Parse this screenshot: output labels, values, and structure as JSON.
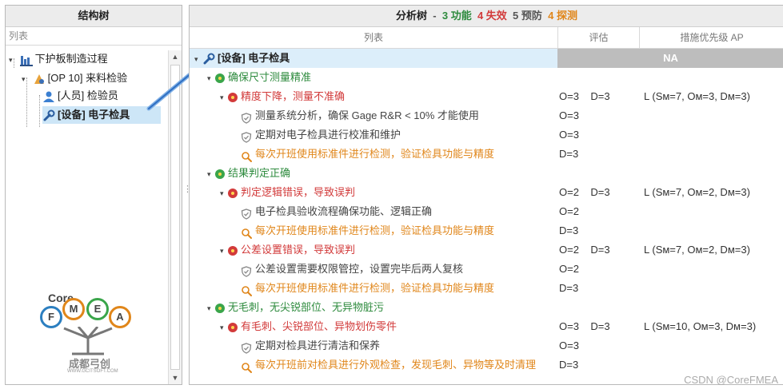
{
  "left": {
    "title": "结构树",
    "column": "列表",
    "nodes": [
      {
        "label": "下护板制造过程"
      },
      {
        "label": "[OP 10] 来料检验"
      },
      {
        "label": "[人员] 检验员"
      },
      {
        "label": "[设备] 电子检具"
      }
    ]
  },
  "right": {
    "title": "分析树",
    "title_sep": "-",
    "counts": {
      "functions": "3 功能",
      "failures": "4 失效",
      "preventions": "5 预防",
      "detections": "4 探测"
    },
    "columns": {
      "list": "列表",
      "eval": "评估",
      "ap": "措施优先级 AP"
    },
    "rows": [
      {
        "kind": "eqp",
        "text": "[设备] 电子检具",
        "ap": "NA"
      },
      {
        "kind": "fn",
        "text": "确保尺寸测量精准"
      },
      {
        "kind": "fm",
        "text": "精度下降，测量不准确",
        "eval": "O=3    D=3",
        "ap": "L  (Sм=7, Oм=3, Dм=3)"
      },
      {
        "kind": "pr",
        "text": "测量系统分析，确保 Gage R&R < 10% 才能使用",
        "eval": "O=3"
      },
      {
        "kind": "pr",
        "text": "定期对电子检具进行校准和维护",
        "eval": "O=3"
      },
      {
        "kind": "dt",
        "text": "每次开班使用标准件进行检测，验证检具功能与精度",
        "eval": "D=3"
      },
      {
        "kind": "fn",
        "text": "结果判定正确"
      },
      {
        "kind": "fm",
        "text": "判定逻辑错误，导致误判",
        "eval": "O=2    D=3",
        "ap": "L  (Sм=7, Oм=2, Dм=3)"
      },
      {
        "kind": "pr",
        "text": "电子检具验收流程确保功能、逻辑正确",
        "eval": "O=2"
      },
      {
        "kind": "dt",
        "text": "每次开班使用标准件进行检测，验证检具功能与精度",
        "eval": "D=3"
      },
      {
        "kind": "fm",
        "text": "公差设置错误，导致误判",
        "eval": "O=2    D=3",
        "ap": "L  (Sм=7, Oм=2, Dм=3)"
      },
      {
        "kind": "pr",
        "text": "公差设置需要权限管控，设置完毕后两人复核",
        "eval": "O=2"
      },
      {
        "kind": "dt",
        "text": "每次开班使用标准件进行检测，验证检具功能与精度",
        "eval": "D=3"
      },
      {
        "kind": "fn",
        "text": "无毛刺，无尖锐部位、无异物脏污"
      },
      {
        "kind": "fm",
        "text": "有毛刺、尖锐部位、异物划伤零件",
        "eval": "O=3    D=3",
        "ap": "L  (Sм=10, Oм=3, Dм=3)"
      },
      {
        "kind": "pr",
        "text": "定期对检具进行清洁和保养",
        "eval": "O=3"
      },
      {
        "kind": "dt",
        "text": "每次开班前对检具进行外观检查，发现毛刺、异物等及时清理",
        "eval": "D=3"
      }
    ]
  },
  "logo": {
    "core": "Core",
    "letters": [
      "F",
      "M",
      "E",
      "A"
    ],
    "cn": "成都弓创",
    "url": "WWW.GCITSOFT.COM"
  },
  "watermark": "CSDN @CoreFMEA",
  "colors": {
    "function": "#2e8b3e",
    "failure": "#d23a3a",
    "detection": "#e0861a",
    "selected": "#cde6f7"
  }
}
